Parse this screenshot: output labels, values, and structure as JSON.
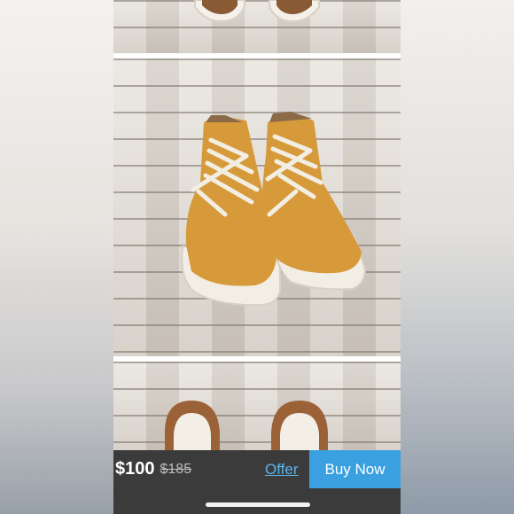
{
  "listing": {
    "price": "$100",
    "original_price": "$185"
  },
  "actions": {
    "offer_label": "Offer",
    "buy_now_label": "Buy Now"
  },
  "photos": [
    {
      "name": "shoe-photo-top",
      "subject": "wheat suede sneakers on wood floor"
    },
    {
      "name": "shoe-photo-main",
      "subject": "wheat suede chukka sneakers"
    },
    {
      "name": "shoe-photo-bottom",
      "subject": "shoe soles on wood floor"
    }
  ],
  "colors": {
    "bar_background": "#3b3b3b",
    "accent_blue": "#3aa0df",
    "offer_link": "#59b4ea"
  }
}
